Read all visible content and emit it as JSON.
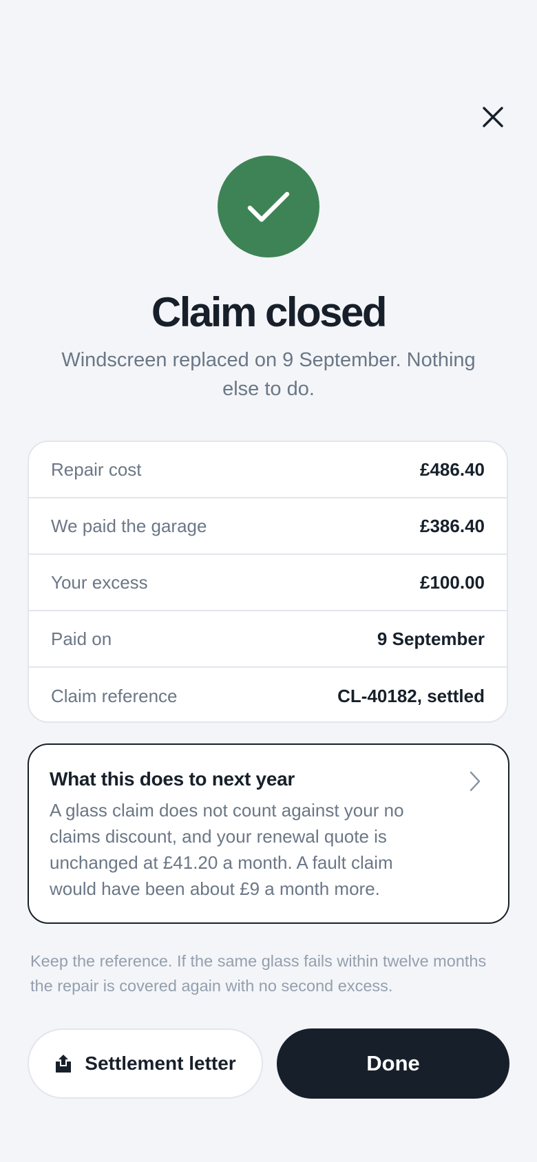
{
  "header": {
    "close_icon": "close-icon"
  },
  "hero": {
    "status_icon": "checkmark-icon",
    "title": "Claim closed",
    "subtitle": "Windscreen replaced on 9 September. Nothing else to do."
  },
  "details": [
    {
      "label": "Repair cost",
      "value": "£486.40"
    },
    {
      "label": "We paid the garage",
      "value": "£386.40"
    },
    {
      "label": "Your excess",
      "value": "£100.00"
    },
    {
      "label": "Paid on",
      "value": "9 September"
    },
    {
      "label": "Claim reference",
      "value": "CL-40182, settled"
    }
  ],
  "info_card": {
    "title": "What this does to next year",
    "body": "A glass claim does not count against your no claims discount, and your renewal quote is unchanged at £41.20 a month. A fault claim would have been about £9 a month more.",
    "chevron_icon": "chevron-right-icon"
  },
  "footnote": "Keep the reference. If the same glass fails within twelve months the repair is covered again with no second excess.",
  "actions": {
    "secondary_label": "Settlement letter",
    "secondary_icon": "share-upload-icon",
    "primary_label": "Done"
  },
  "colors": {
    "background": "#f3f5f8",
    "success": "#3e8355",
    "primary_dark": "#17202a",
    "muted_text": "#6b7786"
  }
}
